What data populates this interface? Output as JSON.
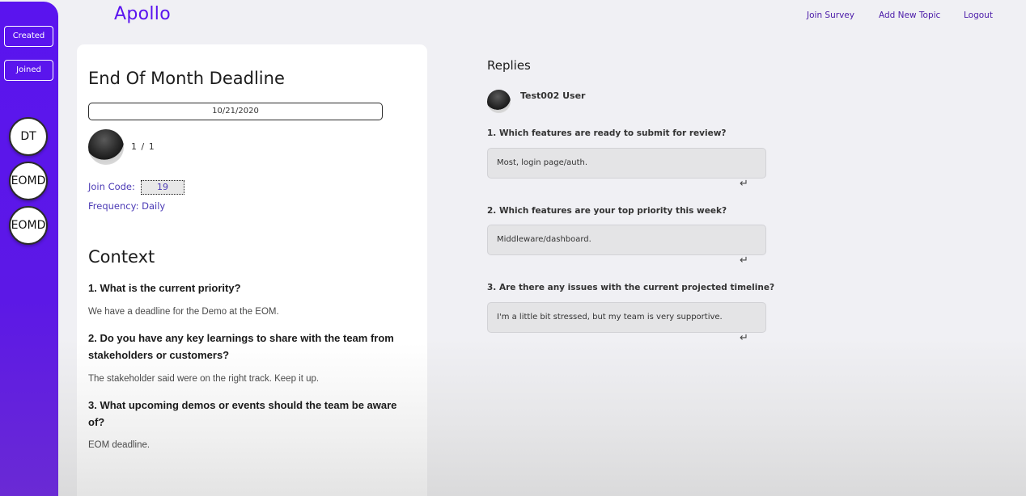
{
  "header": {
    "logo": "Apollo",
    "nav": [
      "Join Survey",
      "Add New Topic",
      "Logout"
    ]
  },
  "sidebar": {
    "buttons": [
      "Created",
      "Joined"
    ],
    "topics": [
      "DT",
      "EOMD",
      "EOMD"
    ]
  },
  "topic": {
    "title": "End Of Month Deadline",
    "date": "10/21/2020",
    "participants": "1 / 1",
    "join_code_label": "Join Code:",
    "join_code": "19",
    "frequency": "Frequency: Daily",
    "context_title": "Context",
    "context": [
      {
        "question": "1. What is the current priority?",
        "answer": "We have a deadline for the Demo at the EOM."
      },
      {
        "question": "2. Do you have any key learnings to share with the team from stakeholders or customers?",
        "answer": "The stakeholder said were on the right track. Keep it up."
      },
      {
        "question": "3. What upcoming demos or events should the team be aware of?",
        "answer": "EOM deadline."
      }
    ]
  },
  "replies": {
    "title": "Replies",
    "user": "Test002 User",
    "items": [
      {
        "question": "1. Which features are ready to submit for review?",
        "answer": "Most, login page/auth."
      },
      {
        "question": "2. Which features are your top priority this week?",
        "answer": "Middleware/dashboard."
      },
      {
        "question": "3. Are there any issues with the current projected timeline?",
        "answer": "I'm a little bit stressed, but my team is very supportive."
      }
    ],
    "enter_glyph": "↵"
  },
  "colors": {
    "accent": "#5a14ef",
    "link": "#4a1aa8",
    "meta": "#4b3ab5"
  }
}
